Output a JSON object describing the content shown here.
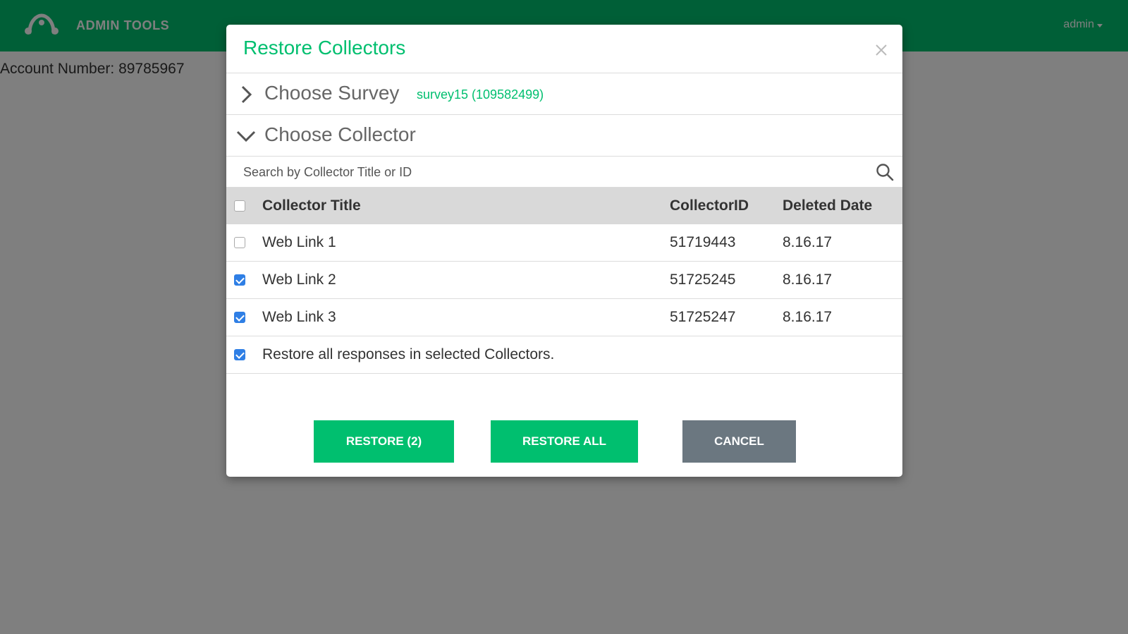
{
  "topbar": {
    "brand": "ADMIN TOOLS",
    "user_menu": "admin",
    "colors": {
      "brand_green": "#00bf6f"
    }
  },
  "page": {
    "account_label": "Account Number: 89785967"
  },
  "modal": {
    "title": "Restore Collectors",
    "close_icon": "close-icon",
    "choose_survey": {
      "label": "Choose Survey",
      "selected": "survey15 (109582499)",
      "icon": "chevron-right-icon"
    },
    "choose_collector": {
      "label": "Choose Collector",
      "icon": "chevron-down-icon"
    },
    "search": {
      "placeholder": "Search by Collector Title or ID",
      "value": ""
    },
    "table": {
      "headers": [
        "Collector Title",
        "CollectorID",
        "Deleted Date"
      ],
      "header_checked": false,
      "rows": [
        {
          "title": "Web Link 1",
          "id": "51719443",
          "date": "8.16.17",
          "checked": false
        },
        {
          "title": "Web Link 2",
          "id": "51725245",
          "date": "8.16.17",
          "checked": true
        },
        {
          "title": "Web Link 3",
          "id": "51725247",
          "date": "8.16.17",
          "checked": true
        }
      ]
    },
    "restore_responses": {
      "label": "Restore all responses in selected Collectors.",
      "checked": true
    },
    "buttons": {
      "restore": "RESTORE (2)",
      "restore_all": "RESTORE ALL",
      "cancel": "CANCEL"
    },
    "colors": {
      "checkbox_blue": "#2f7fe5",
      "cancel_gray": "#6b7780"
    }
  }
}
